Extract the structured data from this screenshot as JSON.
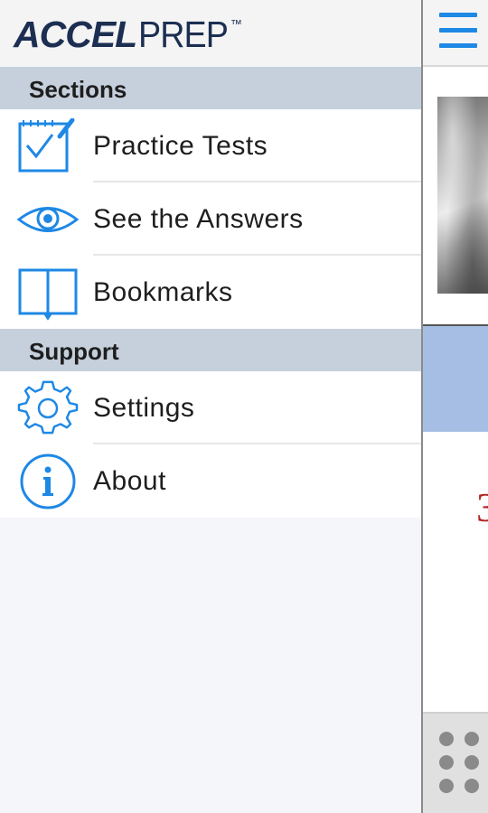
{
  "app": {
    "logo_bold": "ACCEL",
    "logo_light": "PREP",
    "logo_tm": "™"
  },
  "sections": [
    {
      "header": "Sections",
      "items": [
        {
          "label": "Practice Tests",
          "icon": "checklist-icon"
        },
        {
          "label": "See the Answers",
          "icon": "eye-icon"
        },
        {
          "label": "Bookmarks",
          "icon": "book-icon"
        }
      ]
    },
    {
      "header": "Support",
      "items": [
        {
          "label": "Settings",
          "icon": "gear-icon"
        },
        {
          "label": "About",
          "icon": "info-icon"
        }
      ]
    }
  ],
  "main": {
    "partial_digit": "3"
  },
  "colors": {
    "accent": "#1e88e5",
    "logo": "#1c2e52",
    "section_header_bg": "#c6d0dd",
    "band_blue": "#a6bee3",
    "digit_red": "#b52323"
  }
}
